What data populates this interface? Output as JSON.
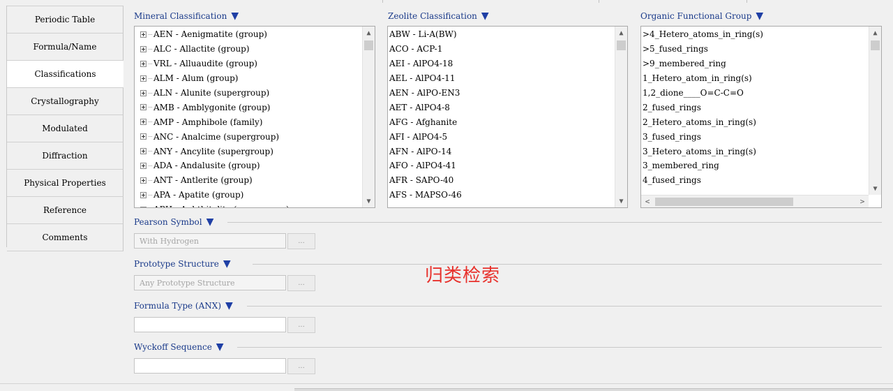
{
  "sidebar": {
    "tabs": [
      {
        "label": "Periodic Table",
        "active": false
      },
      {
        "label": "Formula/Name",
        "active": false
      },
      {
        "label": "Classifications",
        "active": true
      },
      {
        "label": "Crystallography",
        "active": false
      },
      {
        "label": "Modulated",
        "active": false
      },
      {
        "label": "Diffraction",
        "active": false
      },
      {
        "label": "Physical Properties",
        "active": false
      },
      {
        "label": "Reference",
        "active": false
      },
      {
        "label": "Comments",
        "active": false
      }
    ]
  },
  "mineral": {
    "title": "Mineral Classification",
    "items": [
      "AEN - Aenigmatite  (group)",
      "ALC - Allactite  (group)",
      "VRL - Alluaudite  (group)",
      "ALM - Alum  (group)",
      "ALN - Alunite  (supergroup)",
      "AMB - Amblygonite  (group)",
      "AMP - Amphibole  (family)",
      "ANC - Analcime  (supergroup)",
      "ANY - Ancylite  (supergroup)",
      "ADA - Andalusite  (group)",
      "ANT - Antlerite  (group)",
      "APA - Apatite  (group)",
      "APH - Aphthitalite  (supergroup)"
    ]
  },
  "zeolite": {
    "title": "Zeolite Classification",
    "items": [
      "ABW - Li-A(BW)",
      "ACO - ACP-1",
      "AEI - AlPO4-18",
      "AEL - AlPO4-11",
      "AEN - AlPO-EN3",
      "AET - AlPO4-8",
      "AFG - Afghanite",
      "AFI - AlPO4-5",
      "AFN - AlPO-14",
      "AFO - AlPO4-41",
      "AFR - SAPO-40",
      "AFS - MAPSO-46"
    ]
  },
  "organic": {
    "title": "Organic Functional Group",
    "items": [
      ">4_Hetero_atoms_in_ring(s)",
      ">5_fused_rings",
      ">9_membered_ring",
      "1_Hetero_atom_in_ring(s)",
      "1,2_dione____O=C-C=O",
      "2_fused_rings",
      "2_Hetero_atoms_in_ring(s)",
      "3_fused_rings",
      "3_Hetero_atoms_in_ring(s)",
      "3_membered_ring",
      "4_fused_rings"
    ]
  },
  "fields": {
    "pearson": {
      "title": "Pearson Symbol",
      "placeholder": "With Hydrogen",
      "button": "..."
    },
    "prototype": {
      "title": "Prototype Structure",
      "placeholder": "Any Prototype Structure",
      "button": "..."
    },
    "formula_type": {
      "title": "Formula Type (ANX)",
      "placeholder": "",
      "button": "..."
    },
    "wyckoff": {
      "title": "Wyckoff Sequence",
      "placeholder": "",
      "button": "..."
    }
  },
  "annotation": "归类检索",
  "icons": {
    "dropdown": "triangle-down-icon",
    "expand": "plus-box-icon",
    "scroll_up": "chevron-up-icon",
    "scroll_down": "chevron-down-icon",
    "scroll_left": "chevron-left-icon",
    "scroll_right": "chevron-right-icon"
  },
  "colors": {
    "title_text": "#1a3a8a",
    "dropdown_triangle": "#1f3fa5",
    "annotation": "#e8322d",
    "background": "#f0f0f0"
  }
}
